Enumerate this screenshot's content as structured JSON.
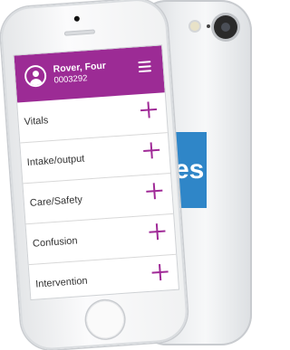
{
  "back_phone": {
    "logo_text": "es",
    "logo_color": "#2f86c8"
  },
  "app": {
    "header_color": "#9c2b95",
    "accent_color": "#a02a97",
    "patient": {
      "name": "Rover, Four",
      "id": "0003292"
    },
    "menu_icon": "hamburger-menu-icon",
    "avatar_icon": "user-avatar-icon",
    "items": [
      {
        "label": "Vitals",
        "icon": "plus-icon"
      },
      {
        "label": "Intake/output",
        "icon": "plus-icon"
      },
      {
        "label": "Care/Safety",
        "icon": "plus-icon"
      },
      {
        "label": "Confusion",
        "icon": "plus-icon"
      },
      {
        "label": "Intervention",
        "icon": "plus-icon"
      }
    ]
  }
}
